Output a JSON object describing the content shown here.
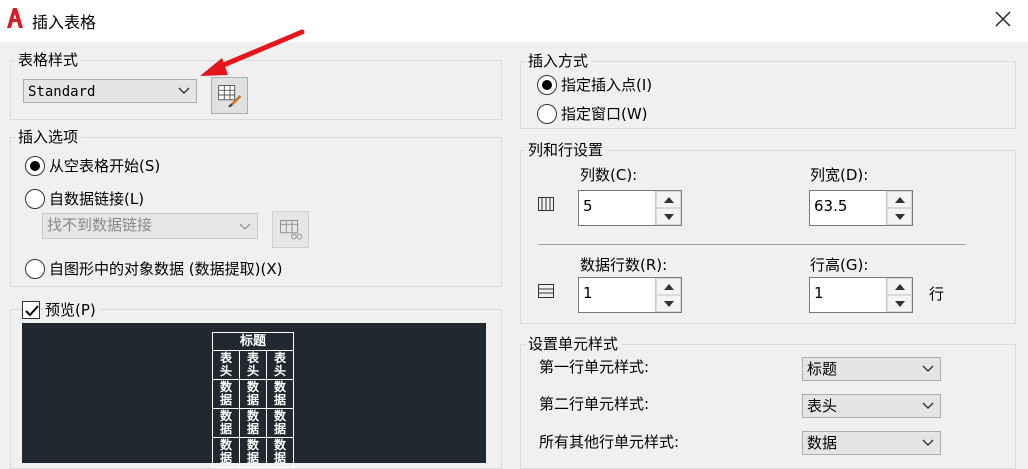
{
  "window": {
    "title": "插入表格"
  },
  "table_style": {
    "group_title": "表格样式",
    "selected": "Standard"
  },
  "insert_options": {
    "group_title": "插入选项",
    "opt_empty": "从空表格开始(S)",
    "opt_data_link": "自数据链接(L)",
    "data_link_combo": "找不到数据链接",
    "opt_object_data": "自图形中的对象数据 (数据提取)(X)"
  },
  "preview": {
    "label": "预览(P)",
    "checked": true,
    "table": {
      "title": "标题",
      "header_cells": [
        "表\n头",
        "表\n头",
        "表\n头"
      ],
      "data_rows": [
        [
          "数\n据",
          "数\n据",
          "数\n据"
        ],
        [
          "数\n据",
          "数\n据",
          "数\n据"
        ],
        [
          "数\n据",
          "数\n据",
          "数\n据"
        ]
      ]
    }
  },
  "insert_method": {
    "group_title": "插入方式",
    "opt_point": "指定插入点(I)",
    "opt_window": "指定窗口(W)"
  },
  "rows_cols": {
    "group_title": "列和行设置",
    "columns_label": "列数(C):",
    "columns_value": "5",
    "col_width_label": "列宽(D):",
    "col_width_value": "63.5",
    "data_rows_label": "数据行数(R):",
    "data_rows_value": "1",
    "row_height_label": "行高(G):",
    "row_height_value": "1",
    "row_unit": "行"
  },
  "cell_styles": {
    "group_title": "设置单元样式",
    "first_row_label": "第一行单元样式:",
    "first_row_value": "标题",
    "second_row_label": "第二行单元样式:",
    "second_row_value": "表头",
    "other_rows_label": "所有其他行单元样式:",
    "other_rows_value": "数据"
  },
  "colors": {
    "arrow": "#e8141c",
    "preview_bg": "#212830",
    "app_icon": "#d21f2a"
  }
}
